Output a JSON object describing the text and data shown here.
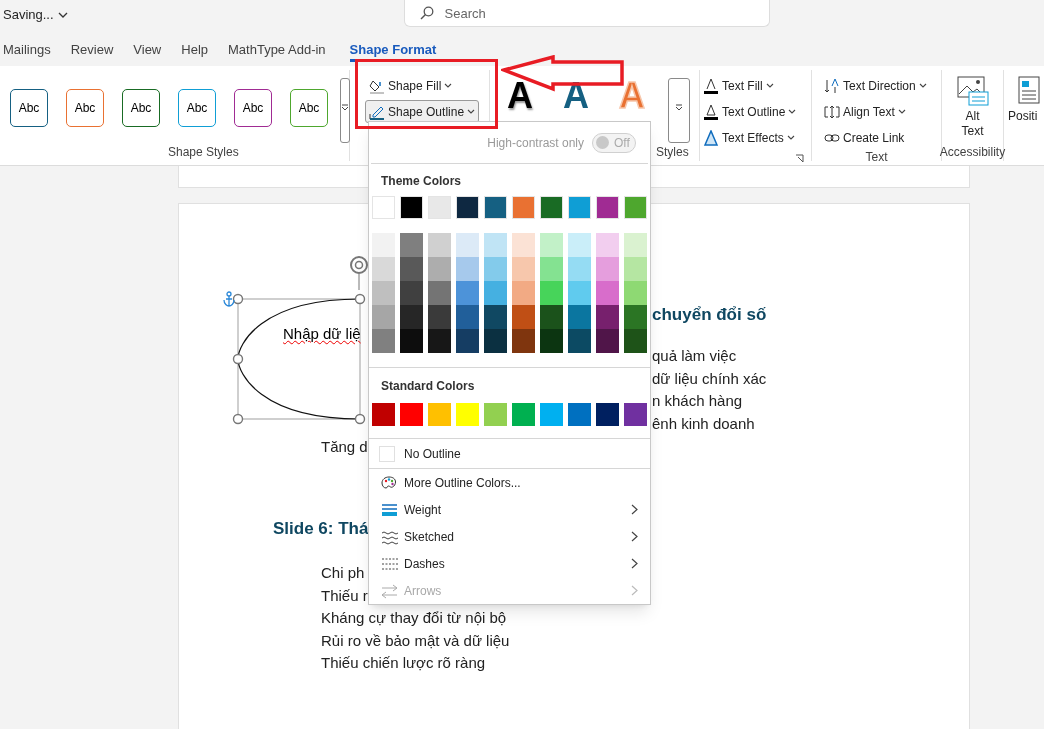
{
  "title_bar": {
    "status": "Saving...",
    "search_placeholder": "Search"
  },
  "tabs": [
    {
      "label": "Mailings",
      "selected": false
    },
    {
      "label": "Review",
      "selected": false
    },
    {
      "label": "View",
      "selected": false
    },
    {
      "label": "Help",
      "selected": false
    },
    {
      "label": "MathType Add-in",
      "selected": false
    },
    {
      "label": "Shape Format",
      "selected": true
    }
  ],
  "ribbon": {
    "shape_styles": {
      "label": "Shape Styles",
      "presets": [
        {
          "label": "Abc",
          "color": "#156082"
        },
        {
          "label": "Abc",
          "color": "#e97132"
        },
        {
          "label": "Abc",
          "color": "#196b24"
        },
        {
          "label": "Abc",
          "color": "#0f9ed5"
        },
        {
          "label": "Abc",
          "color": "#a02b93"
        },
        {
          "label": "Abc",
          "color": "#4ea72e"
        }
      ]
    },
    "shape_buttons": [
      {
        "label": "Shape Fill",
        "expanded": false
      },
      {
        "label": "Shape Outline",
        "expanded": true
      }
    ],
    "wordart": {
      "label": "Styles",
      "presets": [
        {
          "label": "A",
          "kind": "shadow",
          "color": "#000000"
        },
        {
          "label": "A",
          "kind": "fill",
          "color": "#156082"
        },
        {
          "label": "A",
          "kind": "outline",
          "color": "#e97132"
        }
      ]
    },
    "text_format_buttons": [
      "Text Fill",
      "Text Outline",
      "Text Effects"
    ],
    "text_group": {
      "label": "Text",
      "buttons": [
        "Text Direction",
        "Align Text",
        "Create Link"
      ]
    },
    "accessibility": {
      "label": "Accessibility",
      "button": "Alt Text"
    },
    "position": "Positi"
  },
  "outline_menu": {
    "high_contrast": {
      "label": "High-contrast only",
      "toggle_text": "Off",
      "on": false
    },
    "theme_title": "Theme Colors",
    "theme_base": [
      {
        "color": "#ffffff"
      },
      {
        "color": "#000000"
      },
      {
        "color": "#e8e8e8"
      },
      {
        "color": "#0e2841"
      },
      {
        "color": "#156082"
      },
      {
        "color": "#e97132"
      },
      {
        "color": "#196b24"
      },
      {
        "color": "#0f9ed5"
      },
      {
        "color": "#a02b93"
      },
      {
        "color": "#4ea72e"
      }
    ],
    "theme_shades": [
      [
        {
          "color": "#f2f2f2"
        },
        {
          "color": "#d9d9d9"
        },
        {
          "color": "#bfbfbf"
        },
        {
          "color": "#a6a6a6"
        },
        {
          "color": "#808080"
        }
      ],
      [
        {
          "color": "#7f7f7f"
        },
        {
          "color": "#595959"
        },
        {
          "color": "#404040"
        },
        {
          "color": "#262626"
        },
        {
          "color": "#0d0d0d"
        }
      ],
      [
        {
          "color": "#d0d0d0"
        },
        {
          "color": "#adadad"
        },
        {
          "color": "#747474"
        },
        {
          "color": "#3a3a3a"
        },
        {
          "color": "#171717"
        }
      ],
      [
        {
          "color": "#dceaf7"
        },
        {
          "color": "#a6c9ec"
        },
        {
          "color": "#4d93d9"
        },
        {
          "color": "#215f9a"
        },
        {
          "color": "#153d63"
        }
      ],
      [
        {
          "color": "#c0e4f5"
        },
        {
          "color": "#83cbeb"
        },
        {
          "color": "#45b0e1"
        },
        {
          "color": "#104862"
        },
        {
          "color": "#0b3041"
        }
      ],
      [
        {
          "color": "#fbe2d5"
        },
        {
          "color": "#f7c7ac"
        },
        {
          "color": "#f2aa84"
        },
        {
          "color": "#c04f15"
        },
        {
          "color": "#7f350e"
        }
      ],
      [
        {
          "color": "#c2f1c8"
        },
        {
          "color": "#84e291"
        },
        {
          "color": "#47d45a"
        },
        {
          "color": "#1b521b"
        },
        {
          "color": "#0c3511"
        }
      ],
      [
        {
          "color": "#caeef9"
        },
        {
          "color": "#95dcf3"
        },
        {
          "color": "#60cbee"
        },
        {
          "color": "#0b76a0"
        },
        {
          "color": "#0c4a63"
        }
      ],
      [
        {
          "color": "#f2ceef"
        },
        {
          "color": "#e59edd"
        },
        {
          "color": "#d86dcb"
        },
        {
          "color": "#77206d"
        },
        {
          "color": "#501549"
        }
      ],
      [
        {
          "color": "#daf2d0"
        },
        {
          "color": "#b5e6a2"
        },
        {
          "color": "#8ed973"
        },
        {
          "color": "#2b7524"
        },
        {
          "color": "#1e5318"
        }
      ]
    ],
    "standard_title": "Standard Colors",
    "standard": [
      {
        "color": "#c00000"
      },
      {
        "color": "#ff0000"
      },
      {
        "color": "#ffc000"
      },
      {
        "color": "#ffff00"
      },
      {
        "color": "#92d050"
      },
      {
        "color": "#00b050"
      },
      {
        "color": "#00b0f0"
      },
      {
        "color": "#0070c0"
      },
      {
        "color": "#002060"
      },
      {
        "color": "#7030a0"
      }
    ],
    "no_outline": "No Outline",
    "items": [
      {
        "label": "More Outline Colors...",
        "kind": "command",
        "disabled": false
      },
      {
        "label": "Weight",
        "kind": "submenu",
        "disabled": false
      },
      {
        "label": "Sketched",
        "kind": "submenu",
        "disabled": false
      },
      {
        "label": "Dashes",
        "kind": "submenu",
        "disabled": false
      },
      {
        "label": "Arrows",
        "kind": "submenu",
        "disabled": true
      }
    ]
  },
  "document": {
    "shape_text": "Nhập dữ liệ",
    "left_text": "Tăng d",
    "heading_left": "Slide 6: Thá",
    "heading_right": "chuyển đổi số",
    "right_lines": [
      "quả làm việc",
      "dữ liệu chính xác",
      "n khách hàng",
      "ênh kinh doanh"
    ],
    "left_lines": [
      "Chi ph",
      "Thiếu r",
      "Kháng cự thay đổi từ nội bộ",
      "Rủi ro về bảo mật và dữ liệu",
      "Thiếu chiến lược rõ ràng"
    ]
  }
}
